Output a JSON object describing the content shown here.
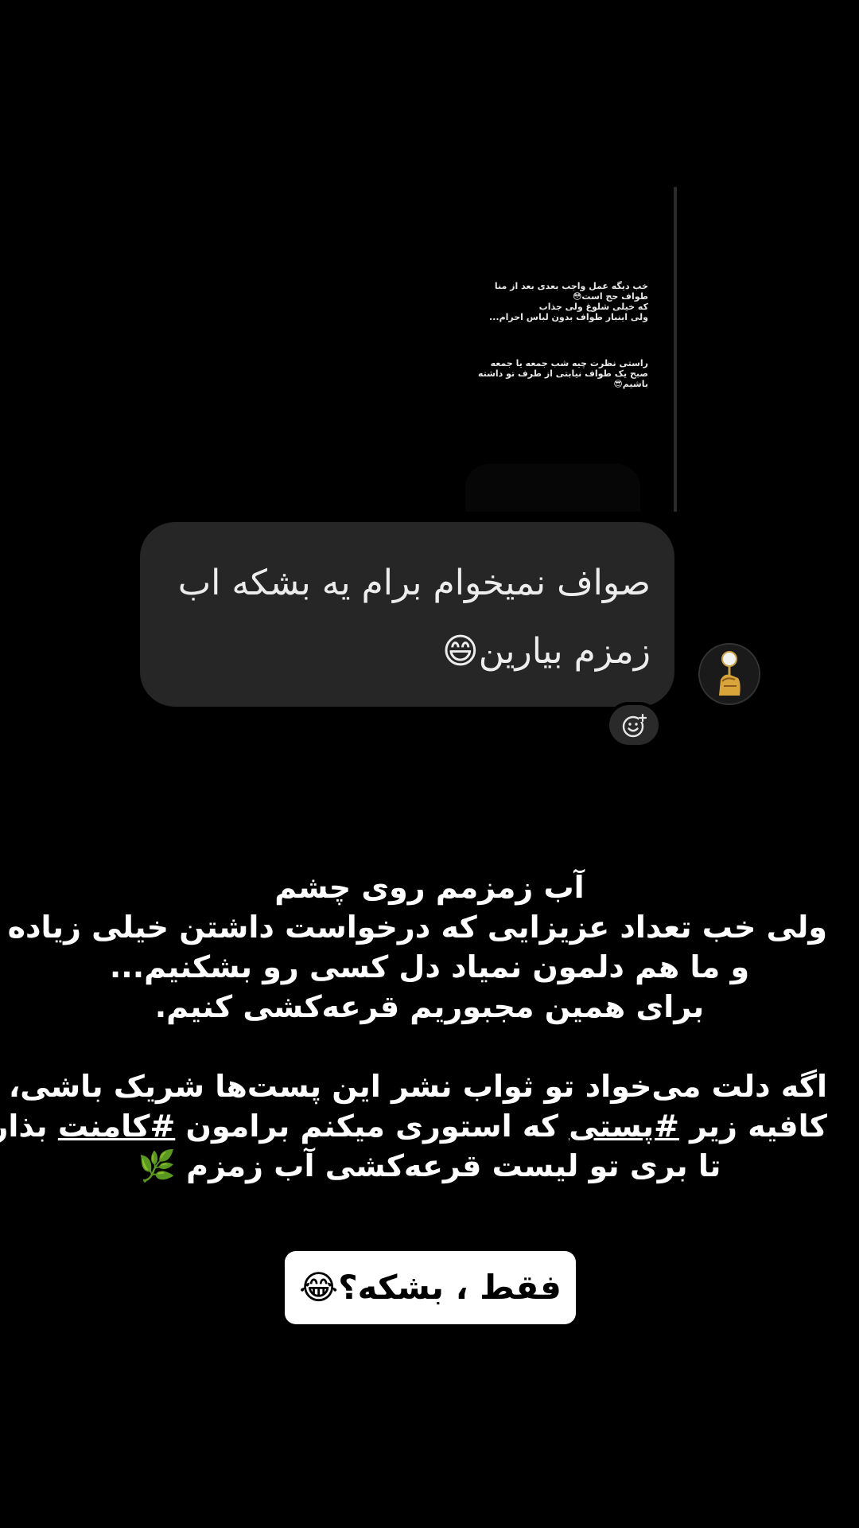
{
  "story_preview": {
    "paragraph1": "خب دیگه عمل واجب بعدی بعد از منا\nطواف حج است😳\nکه خیلی شلوغ ولی جذاب\nولی اینبار طواف بدون لباس احرام...",
    "paragraph2": "راستی نظرت چیه شب جمعه یا جمعه\nصبح یک طواف نیابتی از طرف تو داشته باشیم😎"
  },
  "message": {
    "text": "صواف نمیخوام برام یه بشکه اب\nزمزم بیارین😄"
  },
  "caption": {
    "lines": [
      "آب زمزمم روی چشم",
      "ولی خب تعداد عزیزایی که درخواست داشتن خیلی زیاده",
      "و ما هم دلمون نمیاد دل کسی رو بشکنیم...",
      "برای همین مجبوریم قرعه‌کشی کنیم."
    ],
    "para2_line1": "اگه دلت می‌خواد تو ثواب نشر این پست‌ها شریک باشی،",
    "para2_line2_a": "کافیه زیر ",
    "para2_line2_tag1": "#پستی",
    "para2_line2_b": " که استوری میکنم  برامون ",
    "para2_line2_tag2": "#کامنت",
    "para2_line2_c": " بذاری",
    "para2_line3": "تا بری تو لیست قرعه‌کشی آب زمزم 🌿"
  },
  "pill": {
    "text": "فقط ، بشکه؟😂"
  },
  "icons": {
    "avatar": "avatar-image",
    "reaction": "add-reaction-icon"
  },
  "colors": {
    "background": "#000000",
    "bubble": "#262626",
    "pill": "#ffffff"
  }
}
